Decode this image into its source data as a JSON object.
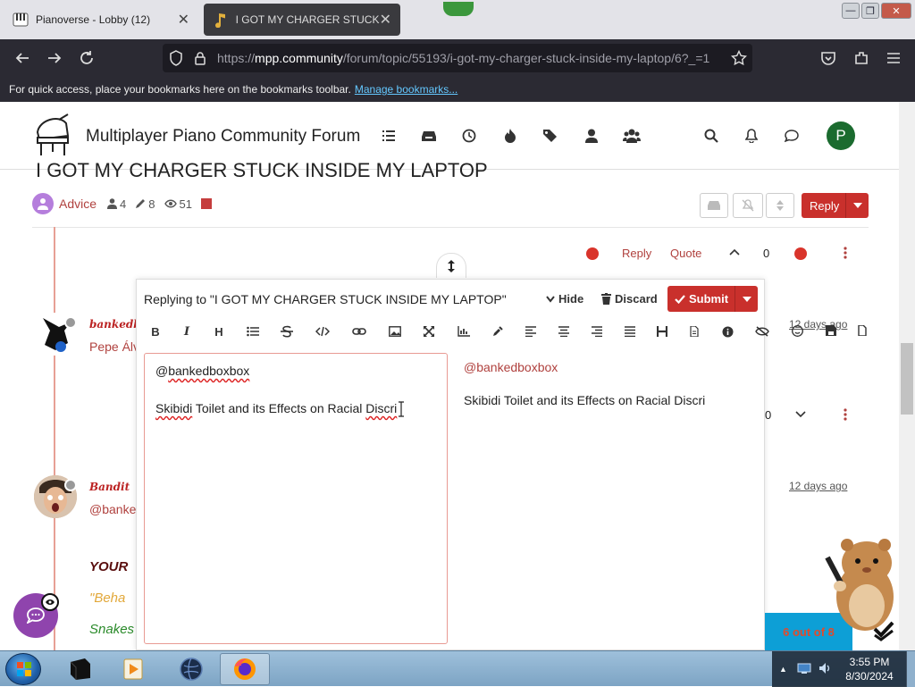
{
  "browser": {
    "tabs": [
      {
        "label": "Pianoverse - Lobby (12)",
        "active": false
      },
      {
        "label": "I GOT MY CHARGER STUCK INS",
        "active": true
      }
    ],
    "url_prefix": "https://",
    "url_domain": "mpp.community",
    "url_rest": "/forum/topic/55193/i-got-my-charger-stuck-inside-my-laptop/6?_=1",
    "bookmarks_message": "For quick access, place your bookmarks here on the bookmarks toolbar.",
    "bookmarks_link": "Manage bookmarks..."
  },
  "forum": {
    "site_title": "Multiplayer Piano Community Forum",
    "user_initial": "P",
    "nav_icons": [
      "list-icon",
      "inbox-icon",
      "clock-icon",
      "fire-icon",
      "tags-icon",
      "user-icon",
      "users-icon"
    ],
    "right_icons": [
      "search-icon",
      "bell-icon",
      "chat-icon"
    ]
  },
  "topic": {
    "title": "I GOT MY CHARGER STUCK INSIDE MY LAPTOP",
    "category": "Advice",
    "posters": "4",
    "posts": "8",
    "views": "51",
    "reply_label": "Reply"
  },
  "post_actions": {
    "reply": "Reply",
    "quote": "Quote",
    "votes": "0",
    "votes2": "0"
  },
  "posts": [
    {
      "user": "bankedb",
      "preview": "Pepe Álv",
      "ago": "12 days ago"
    },
    {
      "user": "Bandit",
      "preview": "@banke",
      "ago": "12 days ago",
      "lines": [
        "YOUR",
        "\"Beha",
        "Snakes"
      ]
    }
  ],
  "composer": {
    "replying_to": "Replying to \"I GOT MY CHARGER STUCK INSIDE MY LAPTOP\"",
    "hide": "Hide",
    "discard": "Discard",
    "submit": "Submit",
    "editor_line1_at": "@",
    "editor_line1_user": "bankedboxbox",
    "editor_line2_a": "Skibidi",
    "editor_line2_b": " Toilet and its Effects on Racial ",
    "editor_line2_c": "Discri",
    "preview_mention": "@bankedboxbox",
    "preview_text": "Skibidi Toilet and its Effects on Racial Discri",
    "toolbar": [
      "B",
      "I",
      "H"
    ]
  },
  "progress": "6 out of 8",
  "taskbar": {
    "time": "3:55 PM",
    "date": "8/30/2024"
  },
  "colors": {
    "accent": "#c9302c",
    "link": "#b0413e",
    "browser_dark": "#2b2a33",
    "fab": "#8f44ad",
    "progress_bg": "#0d9fd6"
  }
}
